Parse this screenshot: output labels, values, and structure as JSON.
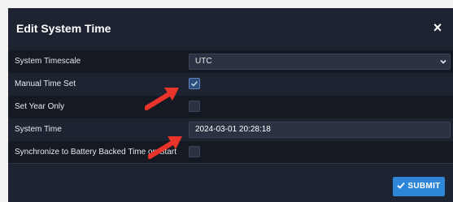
{
  "dialog": {
    "title": "Edit System Time",
    "close_glyph": "×"
  },
  "rows": [
    {
      "label": "System Timescale",
      "type": "select",
      "value": "UTC"
    },
    {
      "label": "Manual Time Set",
      "type": "checkbox",
      "checked": true
    },
    {
      "label": "Set Year Only",
      "type": "checkbox",
      "checked": false
    },
    {
      "label": "System Time",
      "type": "text",
      "value": "2024-03-01 20:28:18"
    },
    {
      "label": "Synchronize to Battery Backed Time on Start",
      "type": "checkbox",
      "checked": false
    }
  ],
  "footer": {
    "submit_label": "SUBMIT"
  },
  "colors": {
    "dialog_bg": "#1d2330",
    "accent": "#2e86d8",
    "annotation_arrow": "#e8342a"
  },
  "icons": {
    "close": "close-icon",
    "select_chevron": "chevron-down-icon",
    "check": "check-icon",
    "submit": "check-icon",
    "annotation": "red-arrow-annotation"
  }
}
